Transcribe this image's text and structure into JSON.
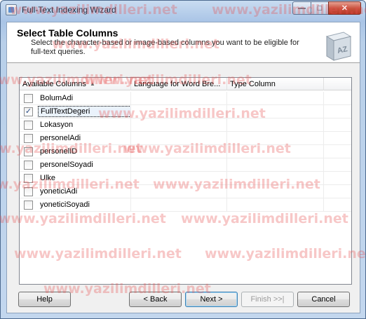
{
  "window": {
    "title": "Full-Text Indexing Wizard",
    "buttons": {
      "minimize": "—",
      "maximize": "□",
      "close": "✕"
    }
  },
  "header": {
    "title": "Select Table Columns",
    "description": "Select the character-based or image-based columns you want to be eligible for full-text queries.",
    "icon": "book-az-icon",
    "icon_text": "AZ"
  },
  "grid": {
    "columns": [
      "Available Columns",
      "Language for Word Bre...",
      "Type Column"
    ],
    "sort_indicator": "▲",
    "rows": [
      {
        "name": "BolumAdi",
        "checked": false
      },
      {
        "name": "FullTextDegeri",
        "checked": true
      },
      {
        "name": "Lokasyon",
        "checked": false
      },
      {
        "name": "personelAdi",
        "checked": false
      },
      {
        "name": "personelID",
        "checked": false
      },
      {
        "name": "personelSoyadi",
        "checked": false
      },
      {
        "name": "Ulke",
        "checked": false
      },
      {
        "name": "yoneticiAdi",
        "checked": false
      },
      {
        "name": "yoneticiSoyadi",
        "checked": false
      }
    ]
  },
  "buttons": {
    "help": "Help",
    "back": "< Back",
    "next": "Next >",
    "finish": "Finish >>|",
    "cancel": "Cancel"
  },
  "watermark": "www.yazilimdilleri.net",
  "colors": {
    "title_bar": "#b8cfe9",
    "dialog_bg": "#f0f0f0",
    "close_button": "#c7503b",
    "watermark": "#e65050"
  }
}
